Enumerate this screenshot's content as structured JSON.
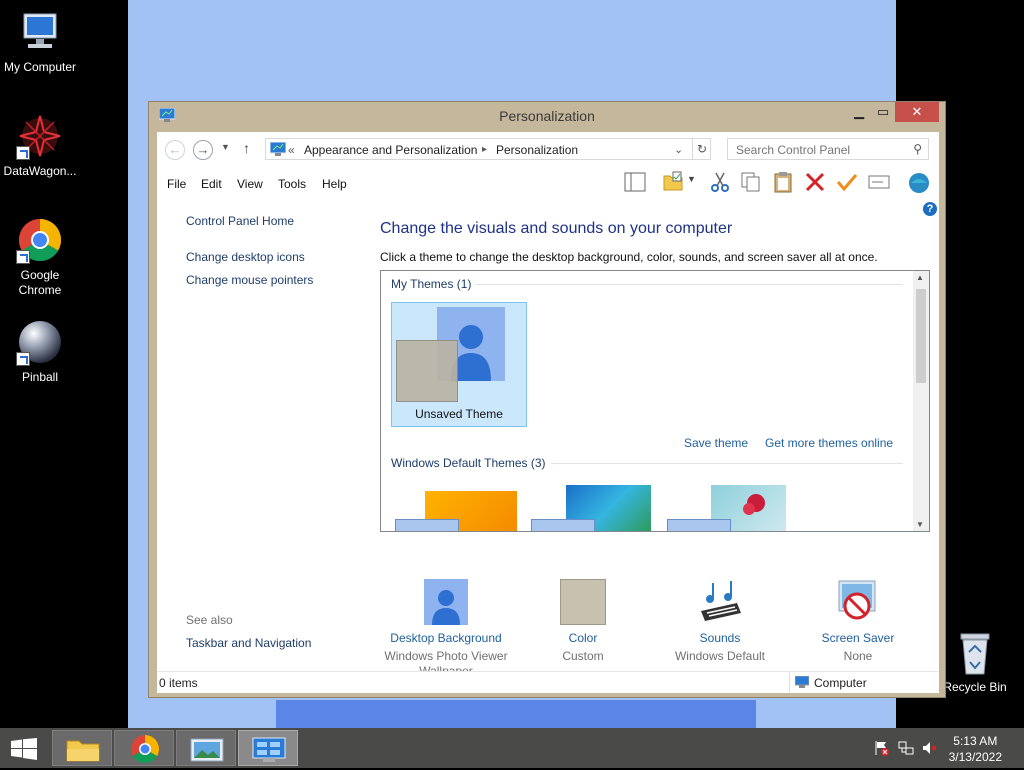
{
  "desktop": {
    "icons": [
      {
        "label": "My Computer"
      },
      {
        "label": "DataWagon..."
      },
      {
        "label": "Google Chrome"
      },
      {
        "label": "Pinball"
      },
      {
        "label": "Recycle Bin"
      }
    ]
  },
  "window": {
    "title": "Personalization",
    "breadcrumb": {
      "prefix": "«",
      "part1": "Appearance and Personalization",
      "separator": "▸",
      "part2": "Personalization"
    },
    "search_placeholder": "Search Control Panel",
    "menu": [
      "File",
      "Edit",
      "View",
      "Tools",
      "Help"
    ],
    "left_pane": {
      "home": "Control Panel Home",
      "links": [
        "Change desktop icons",
        "Change mouse pointers"
      ],
      "see_also_title": "See also",
      "see_also_link": "Taskbar and Navigation"
    },
    "heading": "Change the visuals and sounds on your computer",
    "subtext": "Click a theme to change the desktop background, color, sounds, and screen saver all at once.",
    "my_themes_title": "My Themes (1)",
    "unsaved_theme": "Unsaved Theme",
    "save_theme": "Save theme",
    "get_more_themes": "Get more themes online",
    "default_themes_title": "Windows Default Themes (3)",
    "bottom_items": [
      {
        "label": "Desktop Background",
        "value": "Windows Photo Viewer Wallpaper"
      },
      {
        "label": "Color",
        "value": "Custom"
      },
      {
        "label": "Sounds",
        "value": "Windows Default"
      },
      {
        "label": "Screen Saver",
        "value": "None"
      }
    ],
    "status_left": "0 items",
    "status_right": "Computer"
  },
  "taskbar": {
    "time": "5:13 AM",
    "date": "3/13/2022"
  },
  "colors": {
    "wallpaper_blue": "#a2c2f6",
    "window_frame": "#c4b79c",
    "close_red": "#c7504b",
    "link_blue": "#1e5f9c",
    "heading_blue": "#1e3287"
  }
}
